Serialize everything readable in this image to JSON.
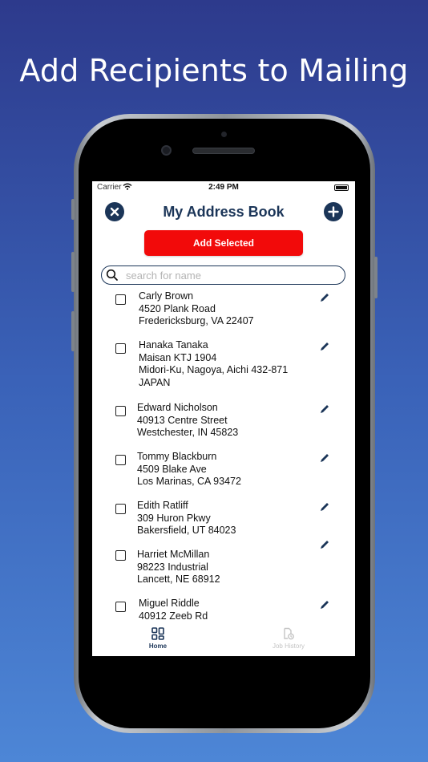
{
  "headline": "Add Recipients to Mailing",
  "status": {
    "carrier": "Carrier",
    "time": "2:49 PM"
  },
  "header": {
    "title": "My Address Book",
    "close_icon": "close-icon",
    "add_icon": "plus-icon"
  },
  "add_selected_label": "Add Selected",
  "search": {
    "placeholder": "search for name"
  },
  "contacts": [
    {
      "lines": [
        "Carly Brown",
        "4520 Plank Road",
        "Fredericksburg, VA  22407"
      ]
    },
    {
      "lines": [
        "Hanaka Tanaka",
        "Maisan KTJ 1904",
        "Midori-Ku, Nagoya, Aichi 432-871",
        "JAPAN"
      ]
    },
    {
      "lines": [
        "Edward Nicholson",
        "40913 Centre Street",
        "Westchester, IN 45823"
      ]
    },
    {
      "lines": [
        "Tommy Blackburn",
        "4509 Blake Ave",
        "Los Marinas, CA 93472"
      ]
    },
    {
      "lines": [
        "Edith Ratliff",
        "309 Huron Pkwy",
        "Bakersfield, UT  84023"
      ]
    },
    {
      "lines": [
        "Harriet McMillan",
        "98223 Industrial",
        "Lancett, NE 68912"
      ]
    },
    {
      "lines": [
        "Miguel Riddle",
        "40912 Zeeb Rd"
      ]
    }
  ],
  "tabbar": {
    "home": "Home",
    "history": "Job History"
  },
  "colors": {
    "navy": "#1b3558",
    "red": "#f20a0a",
    "bg_top": "#2d3a8c",
    "bg_bottom": "#4d86d6"
  }
}
